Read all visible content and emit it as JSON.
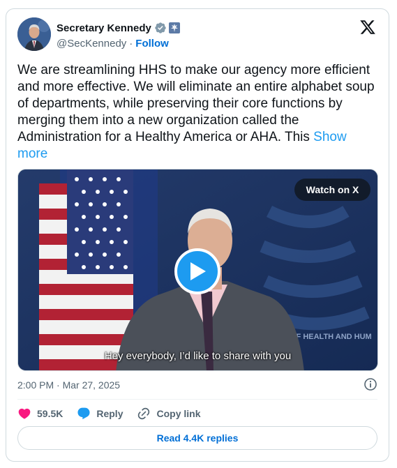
{
  "tweet": {
    "display_name": "Secretary Kennedy",
    "handle": "@SecKennedy",
    "separator": "·",
    "follow_label": "Follow",
    "text": "We are streamlining HHS to make our agency more efficient and more effective. We will eliminate an entire alphabet soup of departments, while preserving their core functions by merging them into a new organization called the Administration for a Healthy America or AHA. This",
    "show_more_label": "Show more",
    "timestamp": "2:00 PM · Mar 27, 2025"
  },
  "video": {
    "watch_label": "Watch on X",
    "subtitle": "Hey everybody, I’d like to share with you",
    "background_text": "OF HEALTH AND HUM"
  },
  "actions": {
    "likes_count": "59.5K",
    "reply_label": "Reply",
    "copy_link_label": "Copy link",
    "read_replies_label": "Read 4.4K replies"
  },
  "colors": {
    "accent": "#1d9bf0",
    "link": "#006fd6",
    "like": "#f91880",
    "muted_text": "#536471",
    "border": "#cfd9de"
  },
  "icons": [
    "verified-badge-icon",
    "government-affiliation-icon",
    "x-logo-icon",
    "play-icon",
    "info-icon",
    "heart-icon",
    "reply-bubble-icon",
    "link-icon"
  ]
}
